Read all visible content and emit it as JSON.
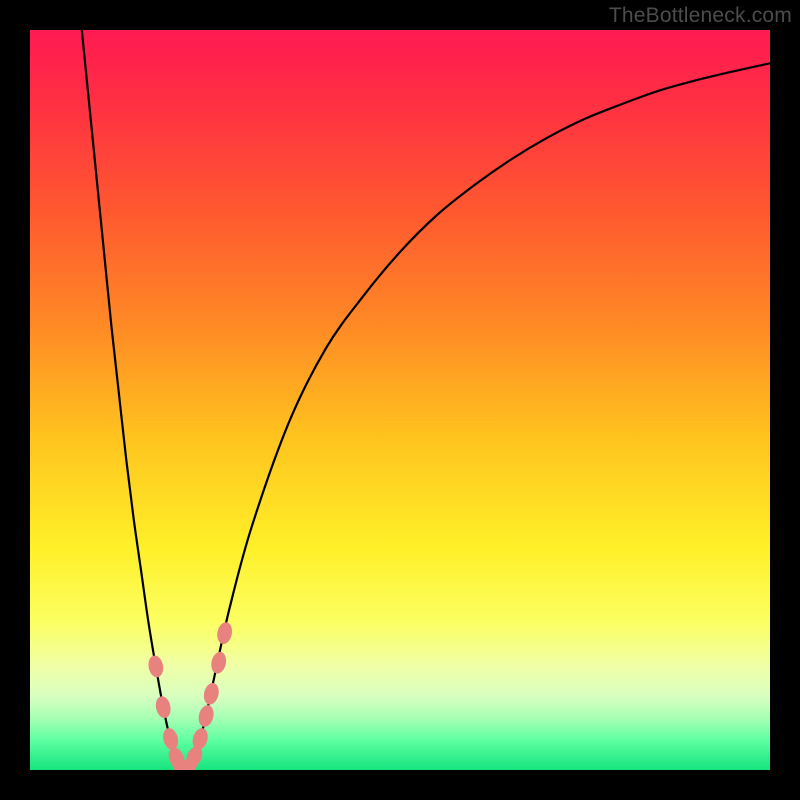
{
  "watermark": "TheBottleneck.com",
  "colors": {
    "black": "#000000",
    "curve_stroke": "#000000",
    "marker_fill": "#e8827f",
    "gradient_stops": [
      {
        "offset": 0.0,
        "color": "#ff1a52"
      },
      {
        "offset": 0.1,
        "color": "#ff3042"
      },
      {
        "offset": 0.25,
        "color": "#ff5a2f"
      },
      {
        "offset": 0.4,
        "color": "#ff8a25"
      },
      {
        "offset": 0.55,
        "color": "#ffc31e"
      },
      {
        "offset": 0.7,
        "color": "#fff028"
      },
      {
        "offset": 0.8,
        "color": "#fcff62"
      },
      {
        "offset": 0.86,
        "color": "#f0ffa8"
      },
      {
        "offset": 0.9,
        "color": "#d8ffc0"
      },
      {
        "offset": 0.93,
        "color": "#a7ffb5"
      },
      {
        "offset": 0.96,
        "color": "#5dffa0"
      },
      {
        "offset": 1.0,
        "color": "#16e47f"
      }
    ]
  },
  "chart_data": {
    "type": "line",
    "title": "",
    "xlabel": "",
    "ylabel": "",
    "xlim": [
      0,
      100
    ],
    "ylim": [
      0,
      100
    ],
    "series": [
      {
        "name": "bottleneck-curve",
        "x": [
          7,
          8,
          9,
          10,
          11,
          12,
          13,
          14,
          15,
          16,
          17,
          18,
          19,
          20,
          21,
          22,
          23,
          24,
          25,
          27,
          30,
          35,
          40,
          45,
          50,
          55,
          60,
          65,
          70,
          75,
          80,
          85,
          90,
          95,
          100
        ],
        "y": [
          100,
          90,
          80,
          70,
          60,
          51,
          42,
          34,
          27,
          20,
          14,
          8.5,
          4,
          1.2,
          0,
          1.2,
          4.2,
          8.3,
          13,
          22,
          33,
          47,
          57,
          64,
          70,
          75,
          79,
          82.5,
          85.5,
          88,
          90,
          91.8,
          93.2,
          94.4,
          95.5
        ]
      }
    ],
    "markers": {
      "name": "highlighted-points",
      "points": [
        {
          "x": 17.0,
          "y": 14.0
        },
        {
          "x": 18.0,
          "y": 8.5
        },
        {
          "x": 19.0,
          "y": 4.2
        },
        {
          "x": 19.8,
          "y": 1.6
        },
        {
          "x": 20.5,
          "y": 0.4
        },
        {
          "x": 21.3,
          "y": 0.4
        },
        {
          "x": 22.2,
          "y": 1.8
        },
        {
          "x": 23.0,
          "y": 4.2
        },
        {
          "x": 23.8,
          "y": 7.3
        },
        {
          "x": 24.5,
          "y": 10.3
        },
        {
          "x": 25.5,
          "y": 14.5
        },
        {
          "x": 26.3,
          "y": 18.5
        }
      ]
    }
  }
}
